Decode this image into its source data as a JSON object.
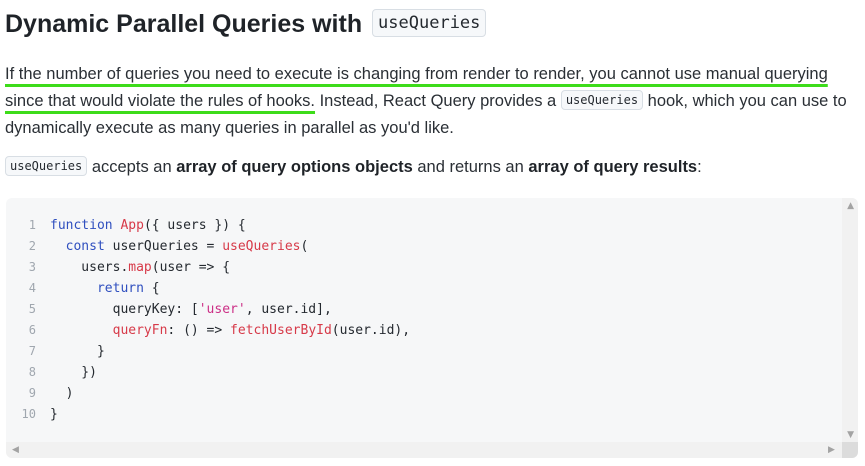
{
  "heading": {
    "text": "Dynamic Parallel Queries with",
    "code": "useQueries"
  },
  "paragraph1": {
    "highlight_line1": "If the number of queries you need to execute is changing from render to render, you cannot use manual querying",
    "highlight_line2": "since that would violate the rules of hooks.",
    "text_before_code": " Instead, React Query provides a ",
    "code": "useQueries",
    "text_after_code": " hook, which you can use to dynamically execute as many queries in parallel as you'd like."
  },
  "paragraph2": {
    "code": "useQueries",
    "t1": " accepts an ",
    "b1": "array of query options objects",
    "t2": " and returns an ",
    "b2": "array of query results",
    "t3": ":"
  },
  "code_block": {
    "lines": [
      {
        "n": "1",
        "tokens": [
          {
            "t": "kw",
            "v": "function "
          },
          {
            "t": "fn",
            "v": "App"
          },
          {
            "t": "plain",
            "v": "({ users }) {"
          }
        ]
      },
      {
        "n": "2",
        "tokens": [
          {
            "t": "plain",
            "v": "  "
          },
          {
            "t": "kw",
            "v": "const "
          },
          {
            "t": "plain",
            "v": "userQueries = "
          },
          {
            "t": "fn",
            "v": "useQueries"
          },
          {
            "t": "plain",
            "v": "("
          }
        ]
      },
      {
        "n": "3",
        "tokens": [
          {
            "t": "plain",
            "v": "    users."
          },
          {
            "t": "fn",
            "v": "map"
          },
          {
            "t": "plain",
            "v": "(user => {"
          }
        ]
      },
      {
        "n": "4",
        "tokens": [
          {
            "t": "plain",
            "v": "      "
          },
          {
            "t": "kw",
            "v": "return "
          },
          {
            "t": "plain",
            "v": "{"
          }
        ]
      },
      {
        "n": "5",
        "tokens": [
          {
            "t": "plain",
            "v": "        queryKey: ["
          },
          {
            "t": "str",
            "v": "'user'"
          },
          {
            "t": "plain",
            "v": ", user.id],"
          }
        ]
      },
      {
        "n": "6",
        "tokens": [
          {
            "t": "plain",
            "v": "        "
          },
          {
            "t": "fn",
            "v": "queryFn"
          },
          {
            "t": "plain",
            "v": ": () => "
          },
          {
            "t": "fn",
            "v": "fetchUserById"
          },
          {
            "t": "plain",
            "v": "(user.id),"
          }
        ]
      },
      {
        "n": "7",
        "tokens": [
          {
            "t": "plain",
            "v": "      }"
          }
        ]
      },
      {
        "n": "8",
        "tokens": [
          {
            "t": "plain",
            "v": "    })"
          }
        ]
      },
      {
        "n": "9",
        "tokens": [
          {
            "t": "plain",
            "v": "  )"
          }
        ]
      },
      {
        "n": "10",
        "tokens": [
          {
            "t": "plain",
            "v": "}"
          }
        ]
      }
    ]
  },
  "scrollbar": {
    "up": "▲",
    "down": "▼",
    "left": "◀",
    "right": "▶"
  }
}
